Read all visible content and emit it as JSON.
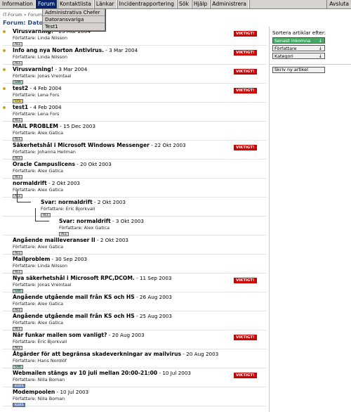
{
  "menubar": {
    "items": [
      "Information",
      "Forum",
      "Kontaktlista",
      "Länkar",
      "Incidentrapportering",
      "Sök",
      "Hjälp",
      "Administrera"
    ],
    "right": "Avsluta",
    "active_index": 1
  },
  "dropdown": {
    "items": [
      "Administrativa Chefer",
      "Datoransvariga",
      "Test1"
    ]
  },
  "breadcrumb": "IT-Forum » Forum",
  "forum_title": "Forum: Datoransvariga",
  "important_label": "VIKTIGT!",
  "posts": [
    {
      "title": "Virusvarning!",
      "date": "23 Mar 2004",
      "author": "Författare: Linda Nilsson",
      "tag": "ALL",
      "important": true,
      "bullet": true,
      "indent": 0
    },
    {
      "title": "Info ang nya Norton Antivirus.",
      "date": "3 Mar 2004",
      "author": "Författare: Linda Nilsson",
      "tag": "ALL",
      "important": true,
      "bullet": true,
      "indent": 0
    },
    {
      "title": "Virusvarning!",
      "date": "3 Mar 2004",
      "author": "Författare: Jonas Vreintaal",
      "tag": "SAK",
      "important": true,
      "bullet": true,
      "indent": 0
    },
    {
      "title": "test2",
      "date": "4 Feb 2004",
      "author": "Författare: Lena Fors",
      "tag": "SYS",
      "important": true,
      "bullet": true,
      "indent": 0
    },
    {
      "title": "test1",
      "date": "4 Feb 2004",
      "author": "Författare: Lena Fors",
      "tag": "ALL",
      "important": false,
      "bullet": true,
      "indent": 0
    },
    {
      "title": "MAIL PROBLEM",
      "date": "15 Dec 2003",
      "author": "Författare: Alex Gatica",
      "tag": "ALL",
      "important": false,
      "bullet": false,
      "indent": 0
    },
    {
      "title": "Säkerhetshål i Microsoft Windows Messenger",
      "date": "22 Okt 2003",
      "author": "Författare: Johanna Hellman",
      "tag": "ALL",
      "important": true,
      "bullet": false,
      "indent": 0
    },
    {
      "title": "Oracle Campuslicens",
      "date": "20 Okt 2003",
      "author": "Författare: Alex Gatica",
      "tag": "ALL",
      "important": false,
      "bullet": false,
      "indent": 0
    },
    {
      "title": "normaldrift",
      "date": "2 Okt 2003",
      "author": "Författare: Alex Gatica",
      "tag": "ALL",
      "important": false,
      "bullet": false,
      "indent": 0
    },
    {
      "title": "Svar: normaldrift",
      "date": "2 Okt 2003",
      "author": "Författare: Eric Bjorkvall",
      "tag": "ALL",
      "important": false,
      "bullet": false,
      "indent": 1
    },
    {
      "title": "Svar: normaldrift",
      "date": "3 Okt 2003",
      "author": "Författare: Alex Gatica",
      "tag": "ALL",
      "important": false,
      "bullet": false,
      "indent": 2
    },
    {
      "title": "Angående mailleveranser II",
      "date": "2 Okt 2003",
      "author": "Författare: Alex Gatica",
      "tag": "ALL",
      "important": false,
      "bullet": false,
      "indent": 0
    },
    {
      "title": "Mailproblem",
      "date": "30 Sep 2003",
      "author": "Författare: Linda Nilsson",
      "tag": "ALL",
      "important": false,
      "bullet": false,
      "indent": 0
    },
    {
      "title": "Nya säkerhetshål i Microsoft RPC,DCOM.",
      "date": "11 Sep 2003",
      "author": "Författare: Jonas Vreintaal",
      "tag": "SAK",
      "important": true,
      "bullet": false,
      "indent": 0
    },
    {
      "title": "Angående utgående mail från KS och HS",
      "date": "26 Aug 2003",
      "author": "Författare: Alex Gatica",
      "tag": "ALL",
      "important": false,
      "bullet": false,
      "indent": 0
    },
    {
      "title": "Angående utgående mail från KS och HS",
      "date": "25 Aug 2003",
      "author": "Författare: Alex Gatica",
      "tag": "ALL",
      "important": false,
      "bullet": false,
      "indent": 0
    },
    {
      "title": "När funkar mailen som vanligt?",
      "date": "20 Aug 2003",
      "author": "Författare: Eric Bjorkvall",
      "tag": "ALL",
      "important": true,
      "bullet": false,
      "indent": 0
    },
    {
      "title": "Åtgärder för att begränsa skadeverkningar av mailvirus",
      "date": "20 Aug 2003",
      "author": "Författare: Hans Nordlöf",
      "tag": "SAK",
      "important": false,
      "bullet": false,
      "indent": 0
    },
    {
      "title": "Webmailen stängs av 10 juli mellan 20:00-21:00",
      "date": "10 Jul 2003",
      "author": "Författare: Nilla Boman",
      "tag": "KURS",
      "important": true,
      "bullet": false,
      "indent": 0
    },
    {
      "title": "Modempoolen",
      "date": "10 Jul 2003",
      "author": "Författare: Nilla Boman",
      "tag": "KURS",
      "important": false,
      "bullet": false,
      "indent": 0
    }
  ],
  "sidebar": {
    "sort_label": "Sortera artiklar efter:",
    "sort_buttons": [
      {
        "label": "Senast inkomna",
        "arrow": "↓",
        "selected": true
      },
      {
        "label": "Författare",
        "arrow": "↓",
        "selected": false
      },
      {
        "label": "Kategori",
        "arrow": "↓",
        "selected": false
      }
    ],
    "write_button": "Skriv ny artikel"
  },
  "colors": {
    "menu_active": "#0a246a",
    "important": "#cc0000",
    "selected_sort": "#44aa66",
    "forum_title": "#2a4a8a"
  }
}
